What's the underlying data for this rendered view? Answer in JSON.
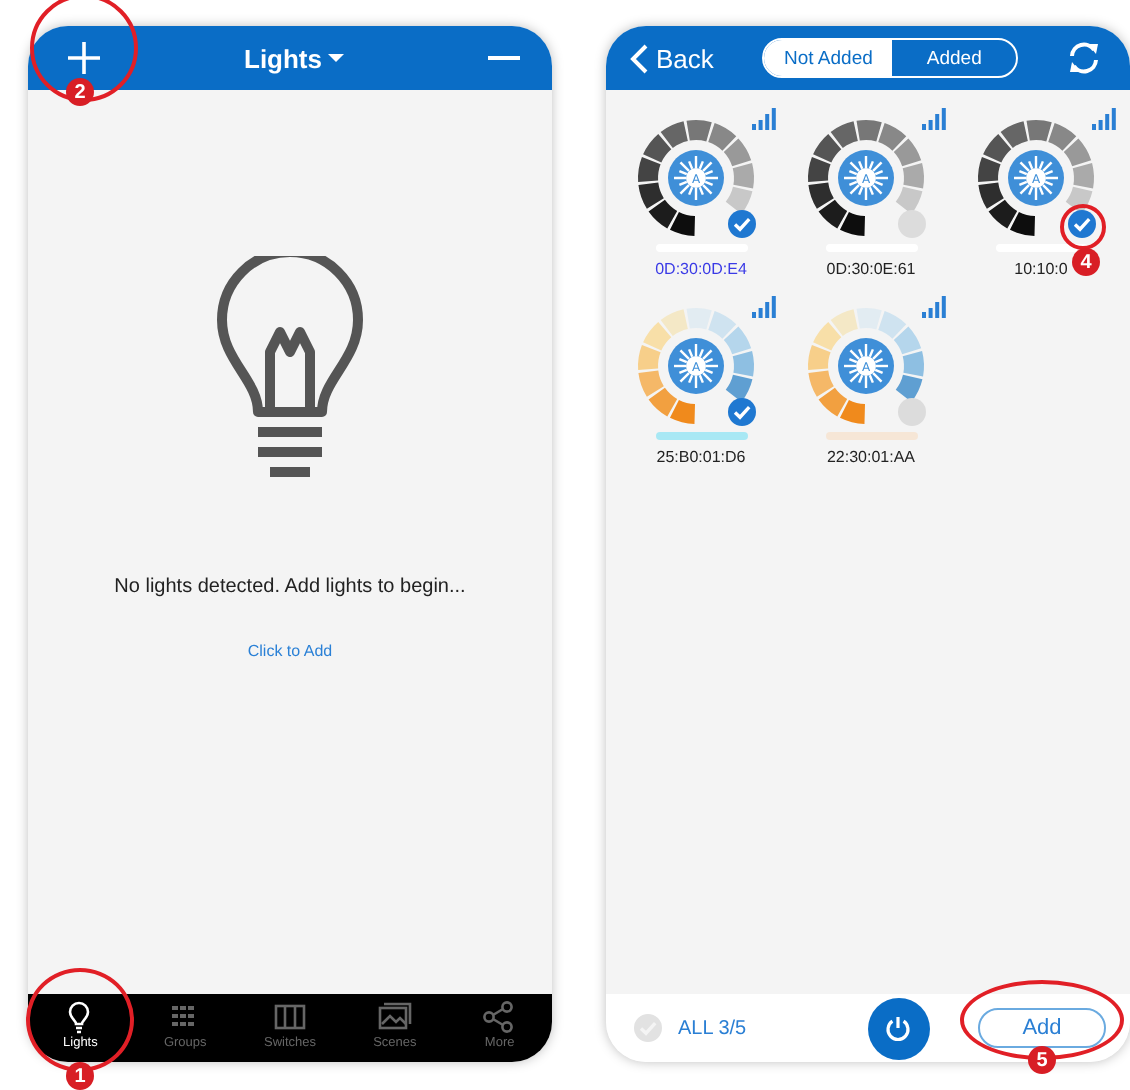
{
  "left_screen": {
    "header": {
      "title": "Lights"
    },
    "empty_state": {
      "message": "No lights detected. Add lights to begin...",
      "link": "Click to Add"
    },
    "tab_bar": [
      {
        "label": "Lights",
        "selected": true
      },
      {
        "label": "Groups",
        "selected": false
      },
      {
        "label": "Switches",
        "selected": false
      },
      {
        "label": "Scenes",
        "selected": false
      },
      {
        "label": "More",
        "selected": false
      }
    ]
  },
  "right_screen": {
    "header": {
      "back": "Back",
      "segments": [
        {
          "label": "Not Added",
          "selected": true
        },
        {
          "label": "Added",
          "selected": false
        }
      ]
    },
    "devices": [
      {
        "name": "0D:30:0D:E4",
        "kind": "monochrome",
        "mode": "A",
        "checked": true,
        "selected": true,
        "color": "#ffffff"
      },
      {
        "name": "0D:30:0E:61",
        "kind": "monochrome",
        "mode": "A",
        "checked": false,
        "selected": false,
        "color": "#ffffff"
      },
      {
        "name": "10:10:0",
        "kind": "monochrome",
        "mode": "A",
        "checked": true,
        "selected": false,
        "color": "#ffffff"
      },
      {
        "name": "25:B0:01:D6",
        "kind": "tunable",
        "mode": "A",
        "checked": true,
        "selected": false,
        "color": "#a8e8f4"
      },
      {
        "name": "22:30:01:AA",
        "kind": "tunable",
        "mode": "A",
        "checked": false,
        "selected": false,
        "color": "#f6e6d6"
      }
    ],
    "footer": {
      "select_all": "ALL 3/5",
      "add_button": "Add"
    }
  },
  "callouts": [
    {
      "number": "2"
    },
    {
      "number": "1"
    },
    {
      "number": "4"
    },
    {
      "number": "5"
    }
  ]
}
